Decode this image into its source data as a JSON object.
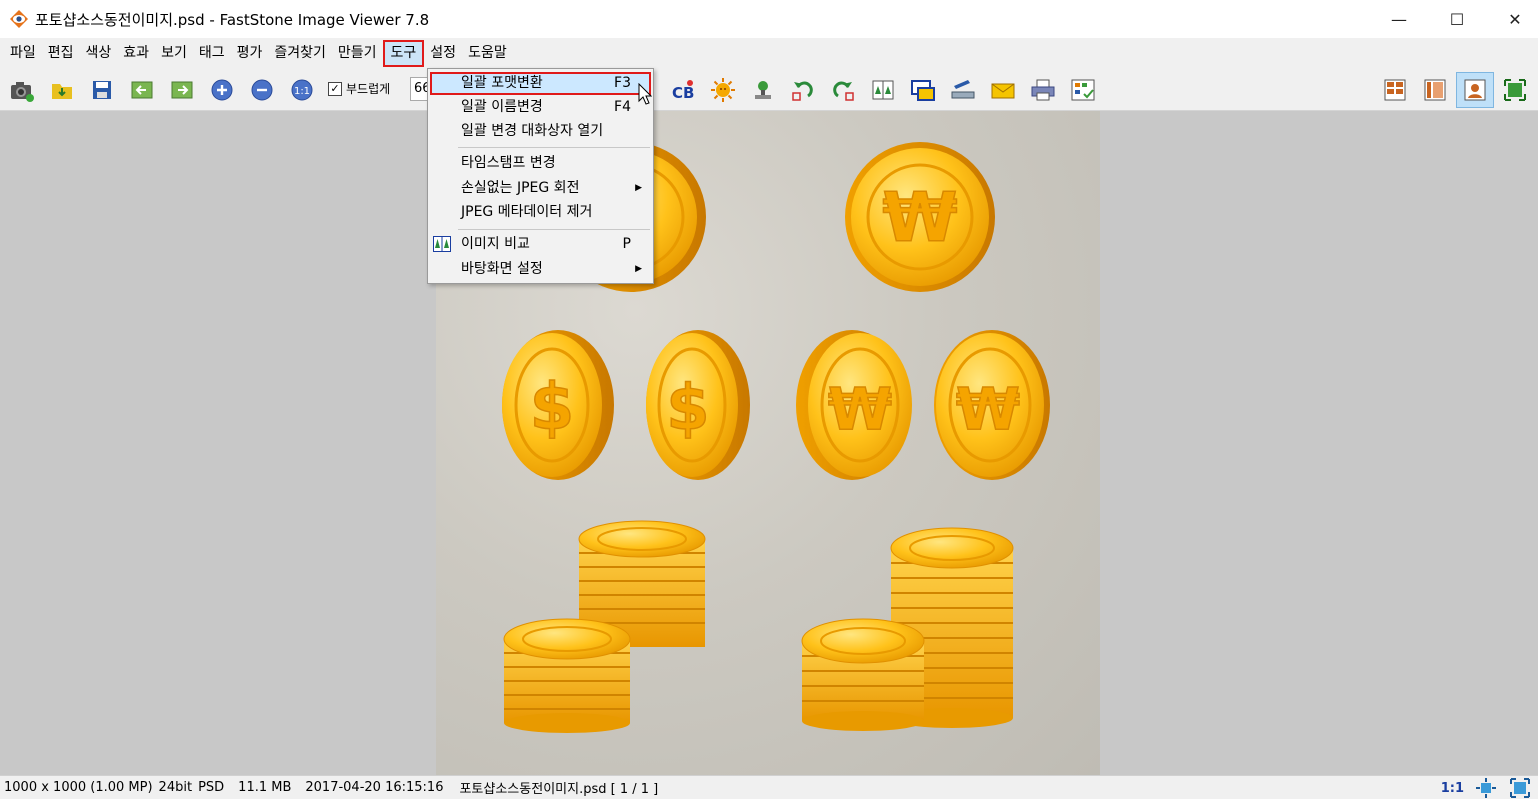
{
  "window": {
    "title": "포토샵소스동전이미지.psd  -  FastStone Image Viewer 7.8",
    "minimize": "—",
    "maximize": "☐",
    "close": "✕"
  },
  "menubar": {
    "items": [
      "파일",
      "편집",
      "색상",
      "효과",
      "보기",
      "태그",
      "평가",
      "즐겨찾기",
      "만들기",
      "도구",
      "설정",
      "도움말"
    ],
    "active_index": 9
  },
  "toolbar": {
    "smooth_label": "부드럽게",
    "smooth_checked": true,
    "zoom_value": "66"
  },
  "dropdown": {
    "items": [
      {
        "label": "일괄 포맷변환",
        "shortcut": "F3"
      },
      {
        "label": "일괄 이름변경",
        "shortcut": "F4"
      },
      {
        "label": "일괄 변경 대화상자 열기",
        "shortcut": ""
      },
      {
        "label": "타임스탬프 변경",
        "shortcut": ""
      },
      {
        "label": "손실없는 JPEG 회전",
        "shortcut": "",
        "submenu": true
      },
      {
        "label": "JPEG 메타데이터 제거",
        "shortcut": ""
      },
      {
        "label": "이미지 비교",
        "shortcut": "P"
      },
      {
        "label": "바탕화면 설정",
        "shortcut": "",
        "submenu": true
      }
    ],
    "highlighted_index": 0
  },
  "statusbar": {
    "dimensions": "1000 x 1000 (1.00 MP)",
    "bitdepth": "24bit",
    "format": "PSD",
    "filesize": "11.1 MB",
    "datetime": "2017-04-20 16:15:16",
    "filename": "포토샵소스동전이미지.psd [ 1 / 1 ]",
    "scale": "1:1"
  },
  "image": {
    "dollar_symbol": "$",
    "won_symbol": "₩"
  },
  "colors": {
    "accent_red": "#e01a1a",
    "coin_gold": "#f5b400",
    "coin_light": "#ffd633",
    "coin_dark": "#d98a00"
  }
}
